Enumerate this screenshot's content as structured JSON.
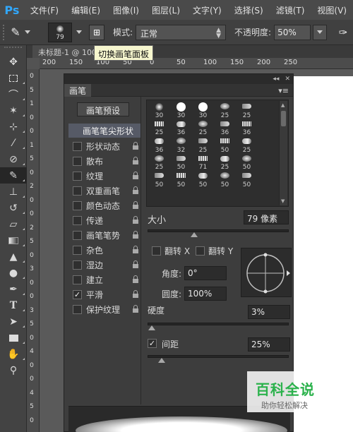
{
  "menubar": {
    "app_logo": "Ps",
    "items": [
      "文件(F)",
      "编辑(E)",
      "图像(I)",
      "图层(L)",
      "文字(Y)",
      "选择(S)",
      "滤镜(T)",
      "视图(V)"
    ]
  },
  "options_bar": {
    "brush_size": "79",
    "mode_label": "模式:",
    "mode_value": "正常",
    "opacity_label": "不透明度:",
    "opacity_value": "50%"
  },
  "document": {
    "tab_title": "未标题-1 @ 100",
    "tooltip": "切换画笔面板",
    "ruler_h_ticks": [
      "200",
      "150",
      "100",
      "50",
      "0",
      "50",
      "100",
      "150",
      "200",
      "250"
    ],
    "ruler_v_ticks": [
      "0",
      "5",
      "1",
      "0",
      "0",
      "1",
      "5",
      "0",
      "2",
      "0",
      "0",
      "2",
      "5",
      "0",
      "3",
      "0",
      "0",
      "3",
      "5",
      "0",
      "4",
      "0",
      "0",
      "4",
      "5",
      "0"
    ]
  },
  "brush_panel": {
    "tab_label": "画笔",
    "presets_button": "画笔预设",
    "tip_shape_header": "画笔笔尖形状",
    "options": [
      {
        "label": "形状动态",
        "checked": false
      },
      {
        "label": "散布",
        "checked": false
      },
      {
        "label": "纹理",
        "checked": false
      },
      {
        "label": "双重画笔",
        "checked": false
      },
      {
        "label": "颜色动态",
        "checked": false
      },
      {
        "label": "传递",
        "checked": false
      },
      {
        "label": "画笔笔势",
        "checked": false
      },
      {
        "label": "杂色",
        "checked": false
      },
      {
        "label": "湿边",
        "checked": false
      },
      {
        "label": "建立",
        "checked": false
      },
      {
        "label": "平滑",
        "checked": true
      },
      {
        "label": "保护纹理",
        "checked": false
      }
    ],
    "tip_grid": [
      [
        "30",
        "30",
        "30",
        "25",
        "25"
      ],
      [
        "25",
        "36",
        "25",
        "36",
        "36"
      ],
      [
        "36",
        "32",
        "25",
        "50",
        "25"
      ],
      [
        "25",
        "50",
        "71",
        "25",
        "50"
      ],
      [
        "50",
        "50",
        "50",
        "50",
        "50"
      ]
    ],
    "size_label": "大小",
    "size_value": "79 像素",
    "flip_x_label": "翻转 X",
    "flip_y_label": "翻转 Y",
    "angle_label": "角度:",
    "angle_value": "0°",
    "roundness_label": "圆度:",
    "roundness_value": "100%",
    "hardness_label": "硬度",
    "hardness_value": "3%",
    "spacing_label": "间距",
    "spacing_value": "25%",
    "spacing_checked": true,
    "size_slider": 0.33,
    "hardness_slider": 0.03,
    "spacing_slider": 0.1
  },
  "watermark": {
    "title": "百科全说",
    "subtitle": "助你轻松解决"
  }
}
